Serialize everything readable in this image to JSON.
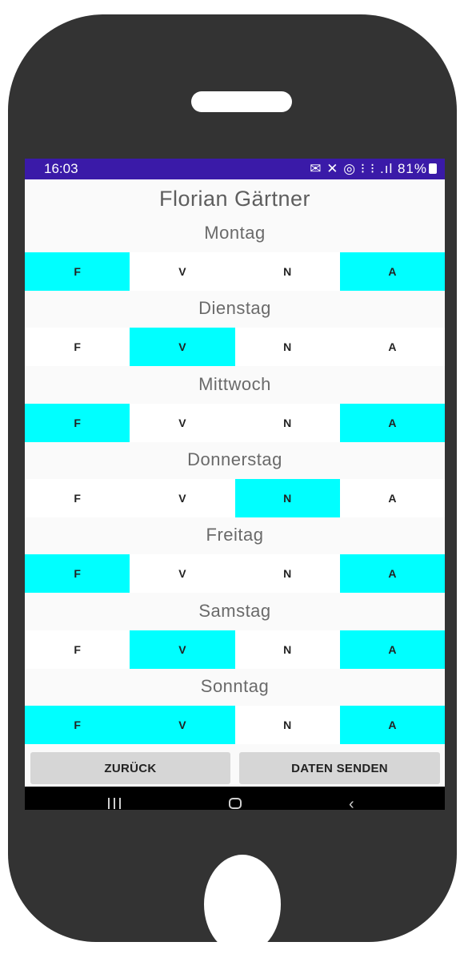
{
  "status_bar": {
    "time": "16:03",
    "icons": "✉ ✕ ◎ ⁝ ⁝ .ıl",
    "battery": "81%"
  },
  "app": {
    "title": "Florian Gärtner"
  },
  "days": [
    {
      "name": "Montag",
      "shifts": [
        {
          "label": "F",
          "selected": true
        },
        {
          "label": "V",
          "selected": false
        },
        {
          "label": "N",
          "selected": false
        },
        {
          "label": "A",
          "selected": true
        }
      ]
    },
    {
      "name": "Dienstag",
      "shifts": [
        {
          "label": "F",
          "selected": false
        },
        {
          "label": "V",
          "selected": true
        },
        {
          "label": "N",
          "selected": false
        },
        {
          "label": "A",
          "selected": false
        }
      ]
    },
    {
      "name": "Mittwoch",
      "shifts": [
        {
          "label": "F",
          "selected": true
        },
        {
          "label": "V",
          "selected": false
        },
        {
          "label": "N",
          "selected": false
        },
        {
          "label": "A",
          "selected": true
        }
      ]
    },
    {
      "name": "Donnerstag",
      "shifts": [
        {
          "label": "F",
          "selected": false
        },
        {
          "label": "V",
          "selected": false
        },
        {
          "label": "N",
          "selected": true
        },
        {
          "label": "A",
          "selected": false
        }
      ]
    },
    {
      "name": "Freitag",
      "shifts": [
        {
          "label": "F",
          "selected": true
        },
        {
          "label": "V",
          "selected": false
        },
        {
          "label": "N",
          "selected": false
        },
        {
          "label": "A",
          "selected": true
        }
      ]
    },
    {
      "name": "Samstag",
      "shifts": [
        {
          "label": "F",
          "selected": false
        },
        {
          "label": "V",
          "selected": true
        },
        {
          "label": "N",
          "selected": false
        },
        {
          "label": "A",
          "selected": true
        }
      ]
    },
    {
      "name": "Sonntag",
      "shifts": [
        {
          "label": "F",
          "selected": true
        },
        {
          "label": "V",
          "selected": true
        },
        {
          "label": "N",
          "selected": false
        },
        {
          "label": "A",
          "selected": true
        }
      ]
    }
  ],
  "buttons": {
    "back_label": "ZURÜCK",
    "send_label": "DATEN SENDEN"
  },
  "colors": {
    "selected": "#00ffff",
    "status_bar": "#3a1aa8",
    "phone_body": "#333333"
  },
  "icons": {
    "nav_recents": "recents-icon",
    "nav_home": "home-icon",
    "nav_back": "back-icon"
  }
}
